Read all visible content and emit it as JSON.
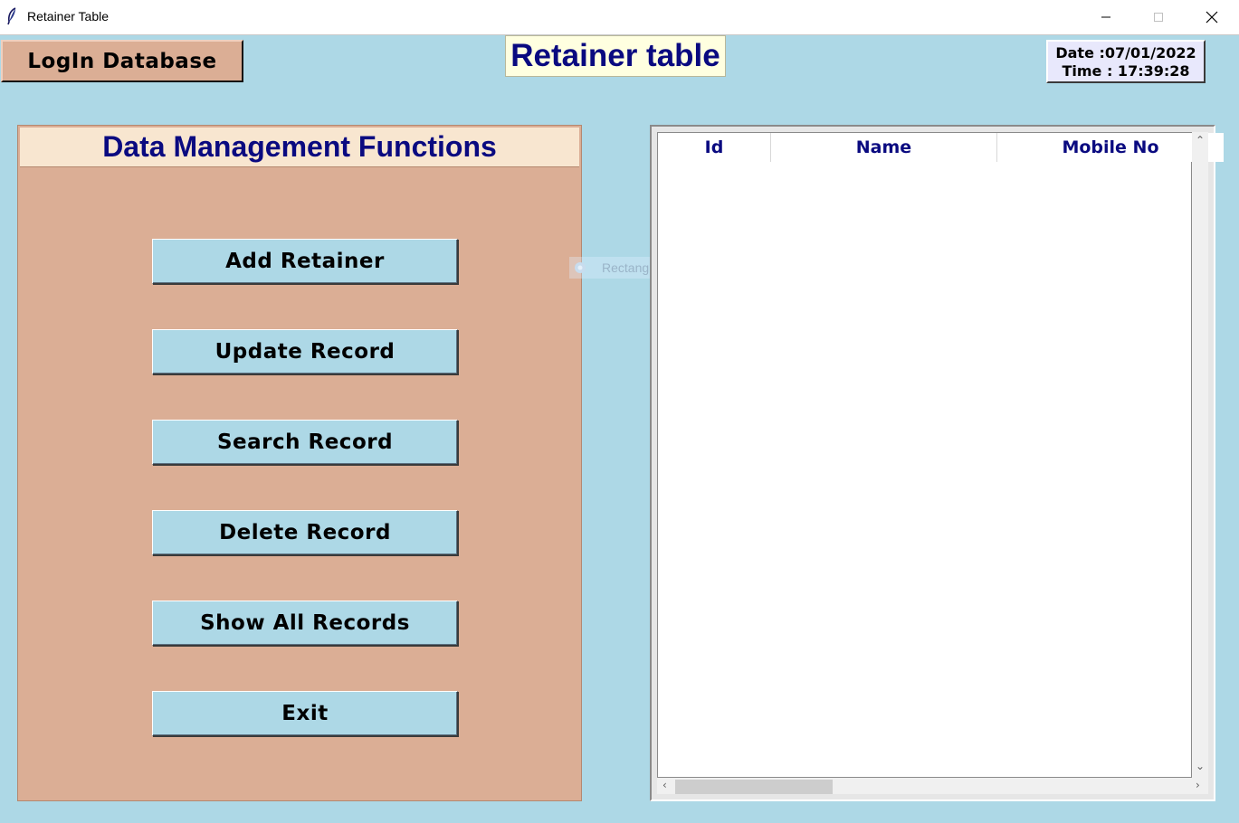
{
  "window": {
    "title": "Retainer Table"
  },
  "header": {
    "login_label": "LogIn Database",
    "page_title": "Retainer table",
    "date_label": "Date :07/01/2022",
    "time_label": "Time : 17:39:28"
  },
  "panel": {
    "title": "Data Management Functions",
    "buttons": [
      {
        "label": "Add Retainer"
      },
      {
        "label": "Update Record"
      },
      {
        "label": "Search Record"
      },
      {
        "label": "Delete Record"
      },
      {
        "label": "Show All Records"
      },
      {
        "label": "Exit"
      }
    ]
  },
  "overlay": {
    "snip_label": "Rectangular Snip"
  },
  "table": {
    "columns": [
      "Id",
      "Name",
      "Mobile No"
    ],
    "rows": []
  },
  "colors": {
    "background": "#add8e6",
    "panel": "#dbae95",
    "title_text": "#0a0a80",
    "title_bg": "#ffffe0"
  }
}
